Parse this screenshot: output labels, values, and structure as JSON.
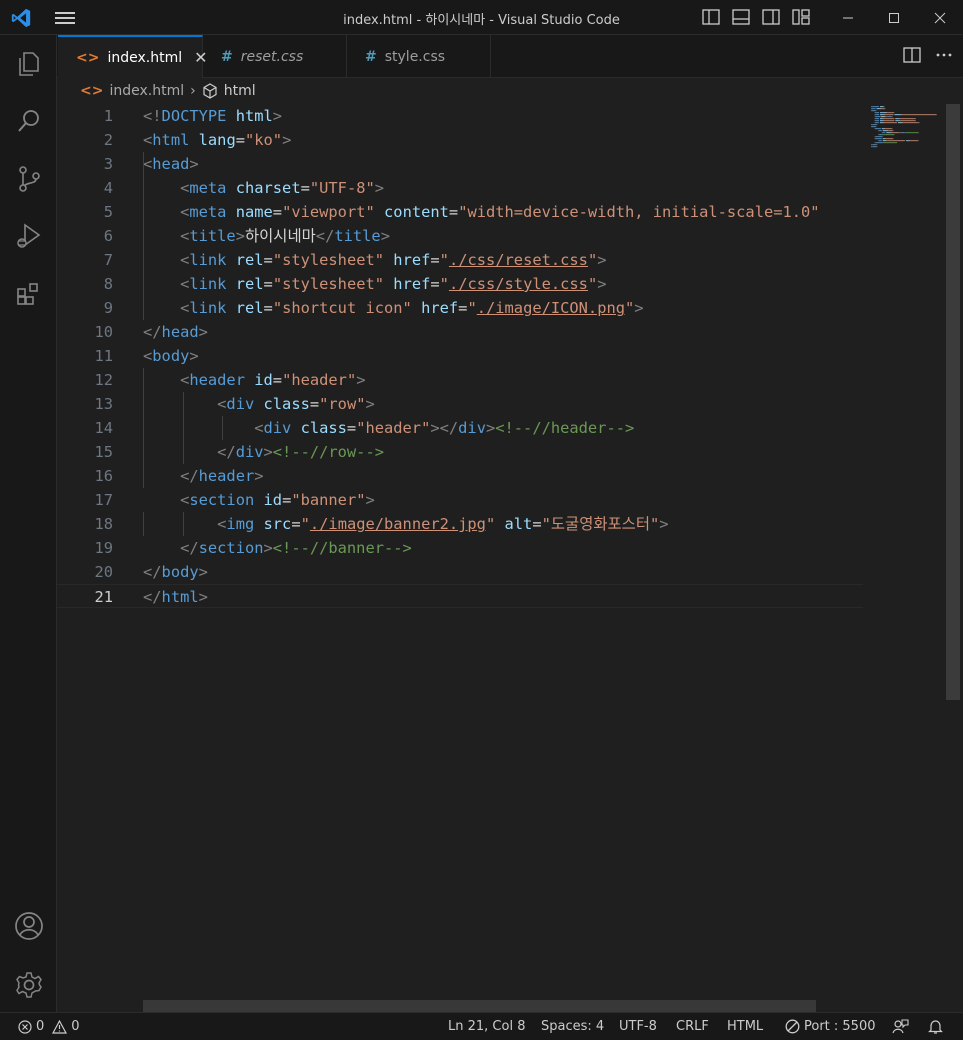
{
  "window": {
    "title": "index.html - 하이시네마 - Visual Studio Code"
  },
  "tabs": [
    {
      "label": "index.html",
      "icon": "<>",
      "active": true
    },
    {
      "label": "reset.css",
      "icon": "#",
      "active": false
    },
    {
      "label": "style.css",
      "icon": "#",
      "active": false
    }
  ],
  "breadcrumb": {
    "file": "index.html",
    "symbol": "html"
  },
  "editor": {
    "current_line": 21,
    "lines": [
      [
        [
          "tag",
          "<!"
        ],
        [
          "name",
          "DOCTYPE"
        ],
        [
          "txt",
          " "
        ],
        [
          "attr",
          "html"
        ],
        [
          "tag",
          ">"
        ]
      ],
      [
        [
          "tag",
          "<"
        ],
        [
          "name",
          "html"
        ],
        [
          "txt",
          " "
        ],
        [
          "attr",
          "lang"
        ],
        [
          "txt",
          "="
        ],
        [
          "str",
          "\"ko\""
        ],
        [
          "tag",
          ">"
        ]
      ],
      [
        [
          "tag",
          "<"
        ],
        [
          "name",
          "head"
        ],
        [
          "tag",
          ">"
        ]
      ],
      [
        [
          "txt",
          "    "
        ],
        [
          "tag",
          "<"
        ],
        [
          "name",
          "meta"
        ],
        [
          "txt",
          " "
        ],
        [
          "attr",
          "charset"
        ],
        [
          "txt",
          "="
        ],
        [
          "str",
          "\"UTF-8\""
        ],
        [
          "tag",
          ">"
        ]
      ],
      [
        [
          "txt",
          "    "
        ],
        [
          "tag",
          "<"
        ],
        [
          "name",
          "meta"
        ],
        [
          "txt",
          " "
        ],
        [
          "attr",
          "name"
        ],
        [
          "txt",
          "="
        ],
        [
          "str",
          "\"viewport\""
        ],
        [
          "txt",
          " "
        ],
        [
          "attr",
          "content"
        ],
        [
          "txt",
          "="
        ],
        [
          "str",
          "\"width=device-width, initial-scale=1.0\""
        ]
      ],
      [
        [
          "txt",
          "    "
        ],
        [
          "tag",
          "<"
        ],
        [
          "name",
          "title"
        ],
        [
          "tag",
          ">"
        ],
        [
          "txt",
          "하이시네마"
        ],
        [
          "tag",
          "</"
        ],
        [
          "name",
          "title"
        ],
        [
          "tag",
          ">"
        ]
      ],
      [
        [
          "txt",
          "    "
        ],
        [
          "tag",
          "<"
        ],
        [
          "name",
          "link"
        ],
        [
          "txt",
          " "
        ],
        [
          "attr",
          "rel"
        ],
        [
          "txt",
          "="
        ],
        [
          "str",
          "\"stylesheet\""
        ],
        [
          "txt",
          " "
        ],
        [
          "attr",
          "href"
        ],
        [
          "txt",
          "="
        ],
        [
          "str",
          "\""
        ],
        [
          "strlink",
          "./css/reset.css"
        ],
        [
          "str",
          "\""
        ],
        [
          "tag",
          ">"
        ]
      ],
      [
        [
          "txt",
          "    "
        ],
        [
          "tag",
          "<"
        ],
        [
          "name",
          "link"
        ],
        [
          "txt",
          " "
        ],
        [
          "attr",
          "rel"
        ],
        [
          "txt",
          "="
        ],
        [
          "str",
          "\"stylesheet\""
        ],
        [
          "txt",
          " "
        ],
        [
          "attr",
          "href"
        ],
        [
          "txt",
          "="
        ],
        [
          "str",
          "\""
        ],
        [
          "strlink",
          "./css/style.css"
        ],
        [
          "str",
          "\""
        ],
        [
          "tag",
          ">"
        ]
      ],
      [
        [
          "txt",
          "    "
        ],
        [
          "tag",
          "<"
        ],
        [
          "name",
          "link"
        ],
        [
          "txt",
          " "
        ],
        [
          "attr",
          "rel"
        ],
        [
          "txt",
          "="
        ],
        [
          "str",
          "\"shortcut icon\""
        ],
        [
          "txt",
          " "
        ],
        [
          "attr",
          "href"
        ],
        [
          "txt",
          "="
        ],
        [
          "str",
          "\""
        ],
        [
          "strlink",
          "./image/ICON.png"
        ],
        [
          "str",
          "\""
        ],
        [
          "tag",
          ">"
        ]
      ],
      [
        [
          "tag",
          "</"
        ],
        [
          "name",
          "head"
        ],
        [
          "tag",
          ">"
        ]
      ],
      [
        [
          "tag",
          "<"
        ],
        [
          "name",
          "body"
        ],
        [
          "tag",
          ">"
        ]
      ],
      [
        [
          "txt",
          "    "
        ],
        [
          "tag",
          "<"
        ],
        [
          "name",
          "header"
        ],
        [
          "txt",
          " "
        ],
        [
          "attr",
          "id"
        ],
        [
          "txt",
          "="
        ],
        [
          "str",
          "\"header\""
        ],
        [
          "tag",
          ">"
        ]
      ],
      [
        [
          "txt",
          "        "
        ],
        [
          "tag",
          "<"
        ],
        [
          "name",
          "div"
        ],
        [
          "txt",
          " "
        ],
        [
          "attr",
          "class"
        ],
        [
          "txt",
          "="
        ],
        [
          "str",
          "\"row\""
        ],
        [
          "tag",
          ">"
        ]
      ],
      [
        [
          "txt",
          "            "
        ],
        [
          "tag",
          "<"
        ],
        [
          "name",
          "div"
        ],
        [
          "txt",
          " "
        ],
        [
          "attr",
          "class"
        ],
        [
          "txt",
          "="
        ],
        [
          "str",
          "\"header\""
        ],
        [
          "tag",
          "></"
        ],
        [
          "name",
          "div"
        ],
        [
          "tag",
          ">"
        ],
        [
          "com",
          "<!--//header-->"
        ]
      ],
      [
        [
          "txt",
          "        "
        ],
        [
          "tag",
          "</"
        ],
        [
          "name",
          "div"
        ],
        [
          "tag",
          ">"
        ],
        [
          "com",
          "<!--//row-->"
        ]
      ],
      [
        [
          "txt",
          "    "
        ],
        [
          "tag",
          "</"
        ],
        [
          "name",
          "header"
        ],
        [
          "tag",
          ">"
        ]
      ],
      [
        [
          "txt",
          "    "
        ],
        [
          "tag",
          "<"
        ],
        [
          "name",
          "section"
        ],
        [
          "txt",
          " "
        ],
        [
          "attr",
          "id"
        ],
        [
          "txt",
          "="
        ],
        [
          "str",
          "\"banner\""
        ],
        [
          "tag",
          ">"
        ]
      ],
      [
        [
          "txt",
          "        "
        ],
        [
          "tag",
          "<"
        ],
        [
          "name",
          "img"
        ],
        [
          "txt",
          " "
        ],
        [
          "attr",
          "src"
        ],
        [
          "txt",
          "="
        ],
        [
          "str",
          "\""
        ],
        [
          "strlink",
          "./image/banner2.jpg"
        ],
        [
          "str",
          "\""
        ],
        [
          "txt",
          " "
        ],
        [
          "attr",
          "alt"
        ],
        [
          "txt",
          "="
        ],
        [
          "str",
          "\"도굴영화포스터\""
        ],
        [
          "tag",
          ">"
        ]
      ],
      [
        [
          "txt",
          "    "
        ],
        [
          "tag",
          "</"
        ],
        [
          "name",
          "section"
        ],
        [
          "tag",
          ">"
        ],
        [
          "com",
          "<!--//banner-->"
        ]
      ],
      [
        [
          "tag",
          "</"
        ],
        [
          "name",
          "body"
        ],
        [
          "tag",
          ">"
        ]
      ],
      [
        [
          "tag",
          "</"
        ],
        [
          "name",
          "html"
        ],
        [
          "tag",
          ">"
        ]
      ]
    ]
  },
  "status": {
    "errors": "0",
    "warnings": "0",
    "position": "Ln 21, Col 8",
    "spaces": "Spaces: 4",
    "encoding": "UTF-8",
    "eol": "CRLF",
    "language": "HTML",
    "port": "Port : 5500"
  },
  "activity_bar": {
    "top": [
      "explorer-icon",
      "search-icon",
      "source-control-icon",
      "run-debug-icon",
      "extensions-icon"
    ],
    "bottom": [
      "account-icon",
      "settings-gear-icon"
    ]
  },
  "colors": {
    "accent": "#0078d4",
    "tag_name": "#569cd6",
    "attribute": "#9cdcfe",
    "string": "#ce9178",
    "comment": "#6a9955"
  }
}
